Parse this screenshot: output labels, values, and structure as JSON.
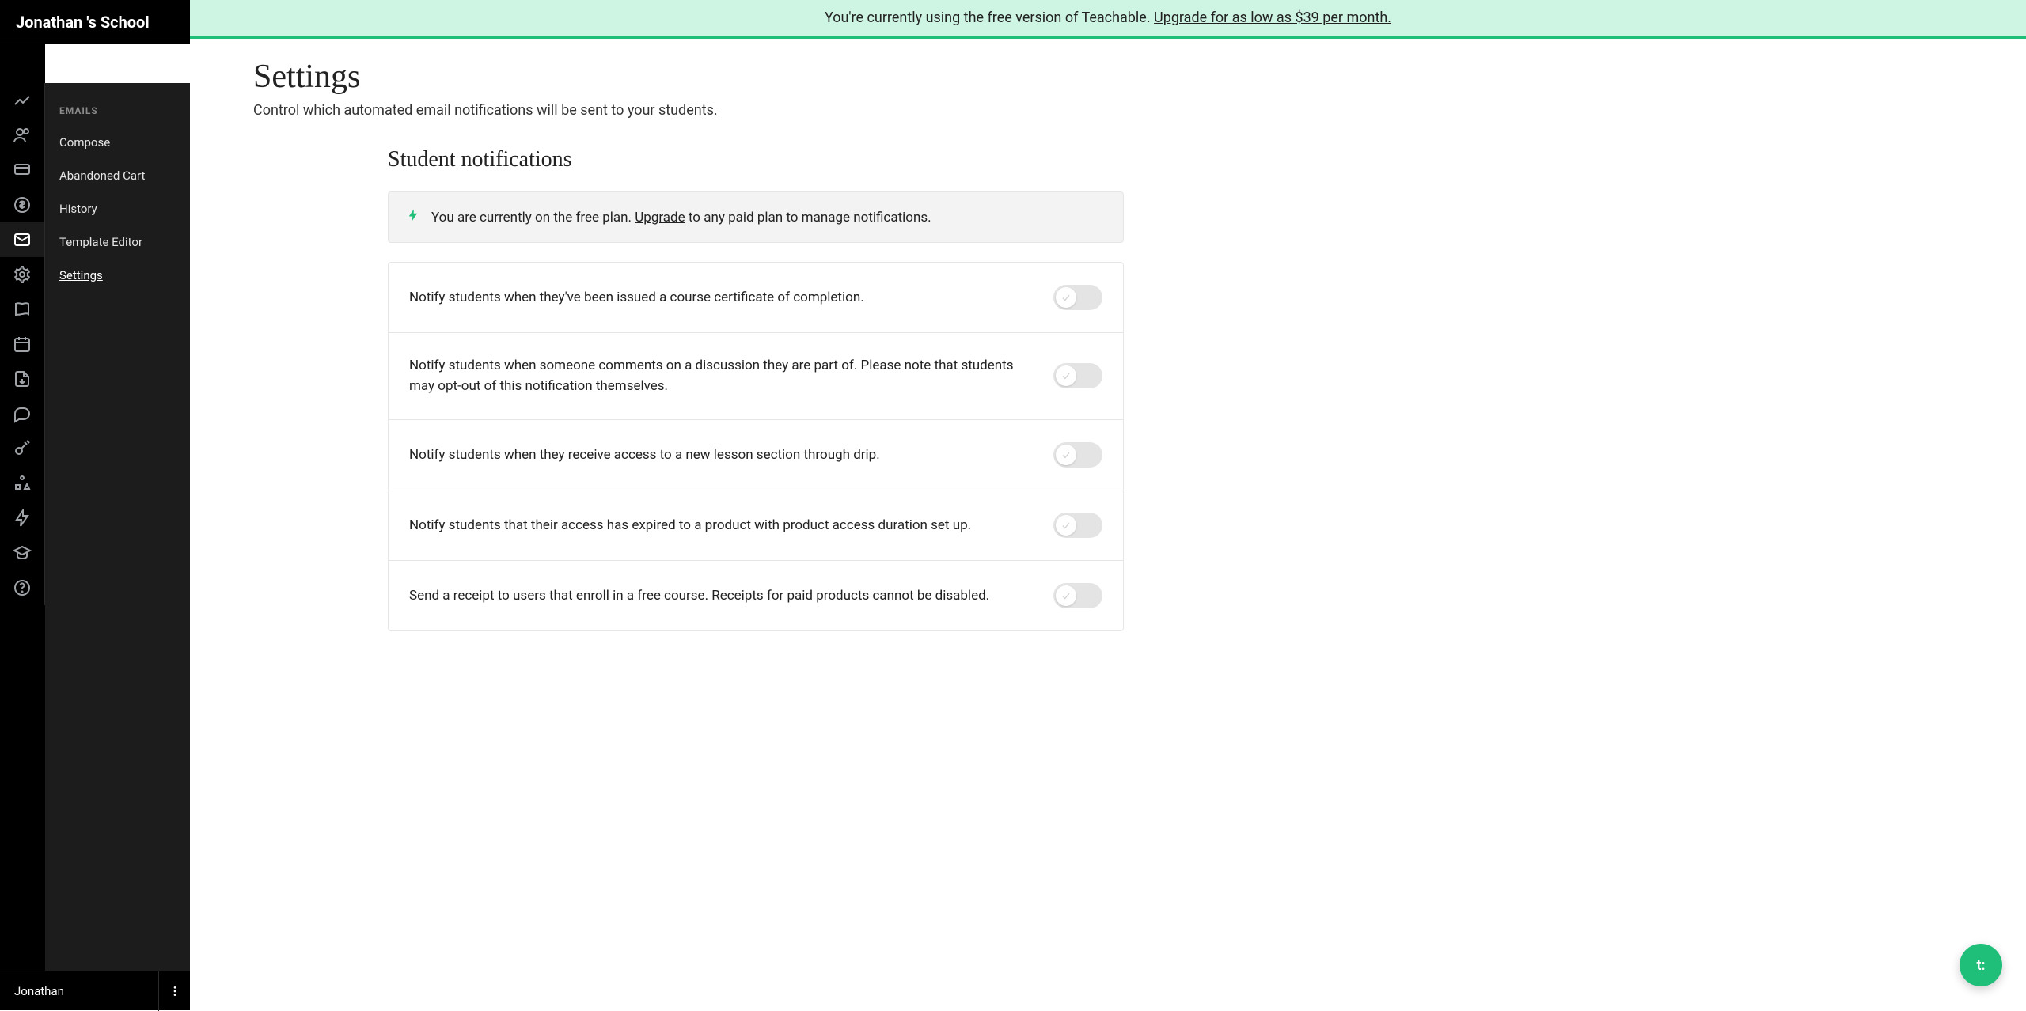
{
  "school_name": "Jonathan 's School",
  "banner": {
    "text_before": "You're currently using the free version of Teachable. ",
    "link_text": "Upgrade for as low as $39 per month."
  },
  "sidebar": {
    "heading": "EMAILS",
    "items": [
      {
        "label": "Compose"
      },
      {
        "label": "Abandoned Cart"
      },
      {
        "label": "History"
      },
      {
        "label": "Template Editor"
      },
      {
        "label": "Settings"
      }
    ]
  },
  "user": {
    "name": "Jonathan"
  },
  "page": {
    "title": "Settings",
    "subtitle": "Control which automated email notifications will be sent to your students."
  },
  "section": {
    "title": "Student notifications"
  },
  "notice": {
    "before": "You are currently on the free plan. ",
    "link": "Upgrade",
    "after": " to any paid plan to manage notifications."
  },
  "settings_rows": [
    {
      "label": "Notify students when they've been issued a course certificate of completion."
    },
    {
      "label": "Notify students when someone comments on a discussion they are part of. Please note that students may opt-out of this notification themselves."
    },
    {
      "label": "Notify students when they receive access to a new lesson section through drip."
    },
    {
      "label": "Notify students that their access has expired to a product with product access duration set up."
    },
    {
      "label": "Send a receipt to users that enroll in a free course. Receipts for paid products cannot be disabled."
    }
  ],
  "chat_fab": {
    "label": "t:"
  }
}
